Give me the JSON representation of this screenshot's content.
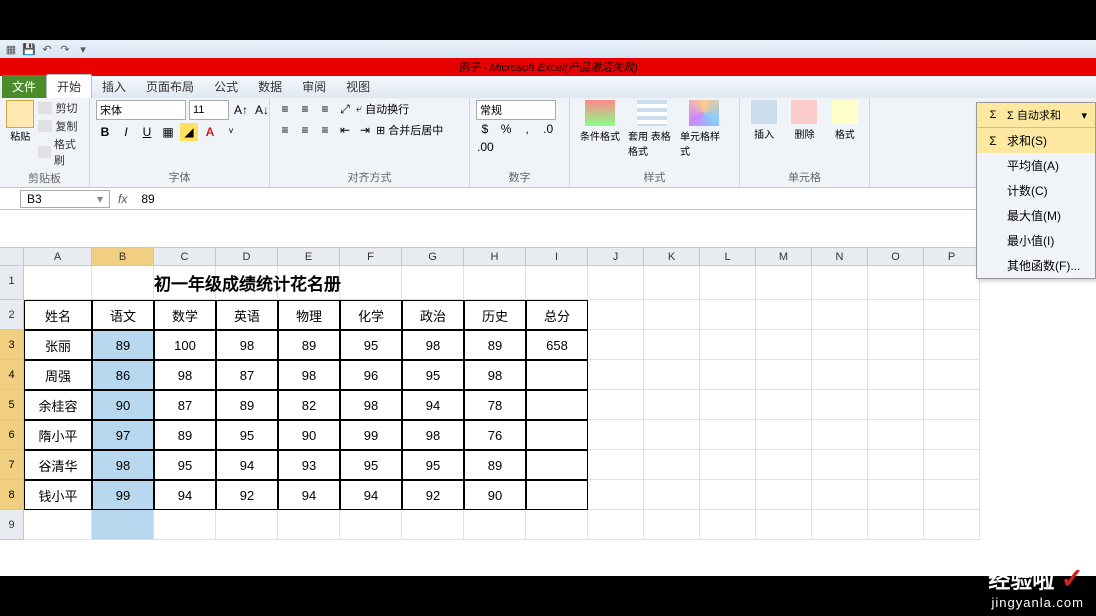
{
  "window_title": "例子 - Microsoft Excel(产品激活失败)",
  "tabs": {
    "file": "文件",
    "items": [
      "开始",
      "插入",
      "页面布局",
      "公式",
      "数据",
      "审阅",
      "视图"
    ]
  },
  "clipboard": {
    "paste": "粘贴",
    "cut": "剪切",
    "copy": "复制",
    "format_painter": "格式刷",
    "group_label": "剪贴板"
  },
  "font": {
    "name": "宋体",
    "size": "11",
    "bold": "B",
    "italic": "I",
    "underline": "U",
    "group_label": "字体"
  },
  "alignment": {
    "wrap": "自动换行",
    "merge": "合并后居中",
    "group_label": "对齐方式"
  },
  "number": {
    "format": "常规",
    "group_label": "数字"
  },
  "styles": {
    "conditional": "条件格式",
    "table": "套用\n表格格式",
    "cell": "单元格样式",
    "group_label": "样式"
  },
  "cells": {
    "insert": "插入",
    "delete": "删除",
    "format": "格式",
    "group_label": "单元格"
  },
  "autosum": {
    "trigger": "Σ 自动求和",
    "items": [
      "求和(S)",
      "平均值(A)",
      "计数(C)",
      "最大值(M)",
      "最小值(I)",
      "其他函数(F)..."
    ]
  },
  "name_box": "B3",
  "formula_value": "89",
  "columns": [
    "A",
    "B",
    "C",
    "D",
    "E",
    "F",
    "G",
    "H",
    "I",
    "J",
    "K",
    "L",
    "M",
    "N",
    "O",
    "P"
  ],
  "rows": [
    "1",
    "2",
    "3",
    "4",
    "5",
    "6",
    "7",
    "8",
    "9"
  ],
  "table": {
    "title": "初一年级成绩统计花名册",
    "headers": [
      "姓名",
      "语文",
      "数学",
      "英语",
      "物理",
      "化学",
      "政治",
      "历史",
      "总分"
    ],
    "data": [
      [
        "张丽",
        "89",
        "100",
        "98",
        "89",
        "95",
        "98",
        "89",
        "658"
      ],
      [
        "周强",
        "86",
        "98",
        "87",
        "98",
        "96",
        "95",
        "98",
        ""
      ],
      [
        "余桂容",
        "90",
        "87",
        "89",
        "82",
        "98",
        "94",
        "78",
        ""
      ],
      [
        "隋小平",
        "97",
        "89",
        "95",
        "90",
        "99",
        "98",
        "76",
        ""
      ],
      [
        "谷清华",
        "98",
        "95",
        "94",
        "93",
        "95",
        "95",
        "89",
        ""
      ],
      [
        "钱小平",
        "99",
        "94",
        "92",
        "94",
        "94",
        "92",
        "90",
        ""
      ]
    ]
  },
  "watermark": {
    "text": "经验啦",
    "url": "jingyanla.com"
  }
}
